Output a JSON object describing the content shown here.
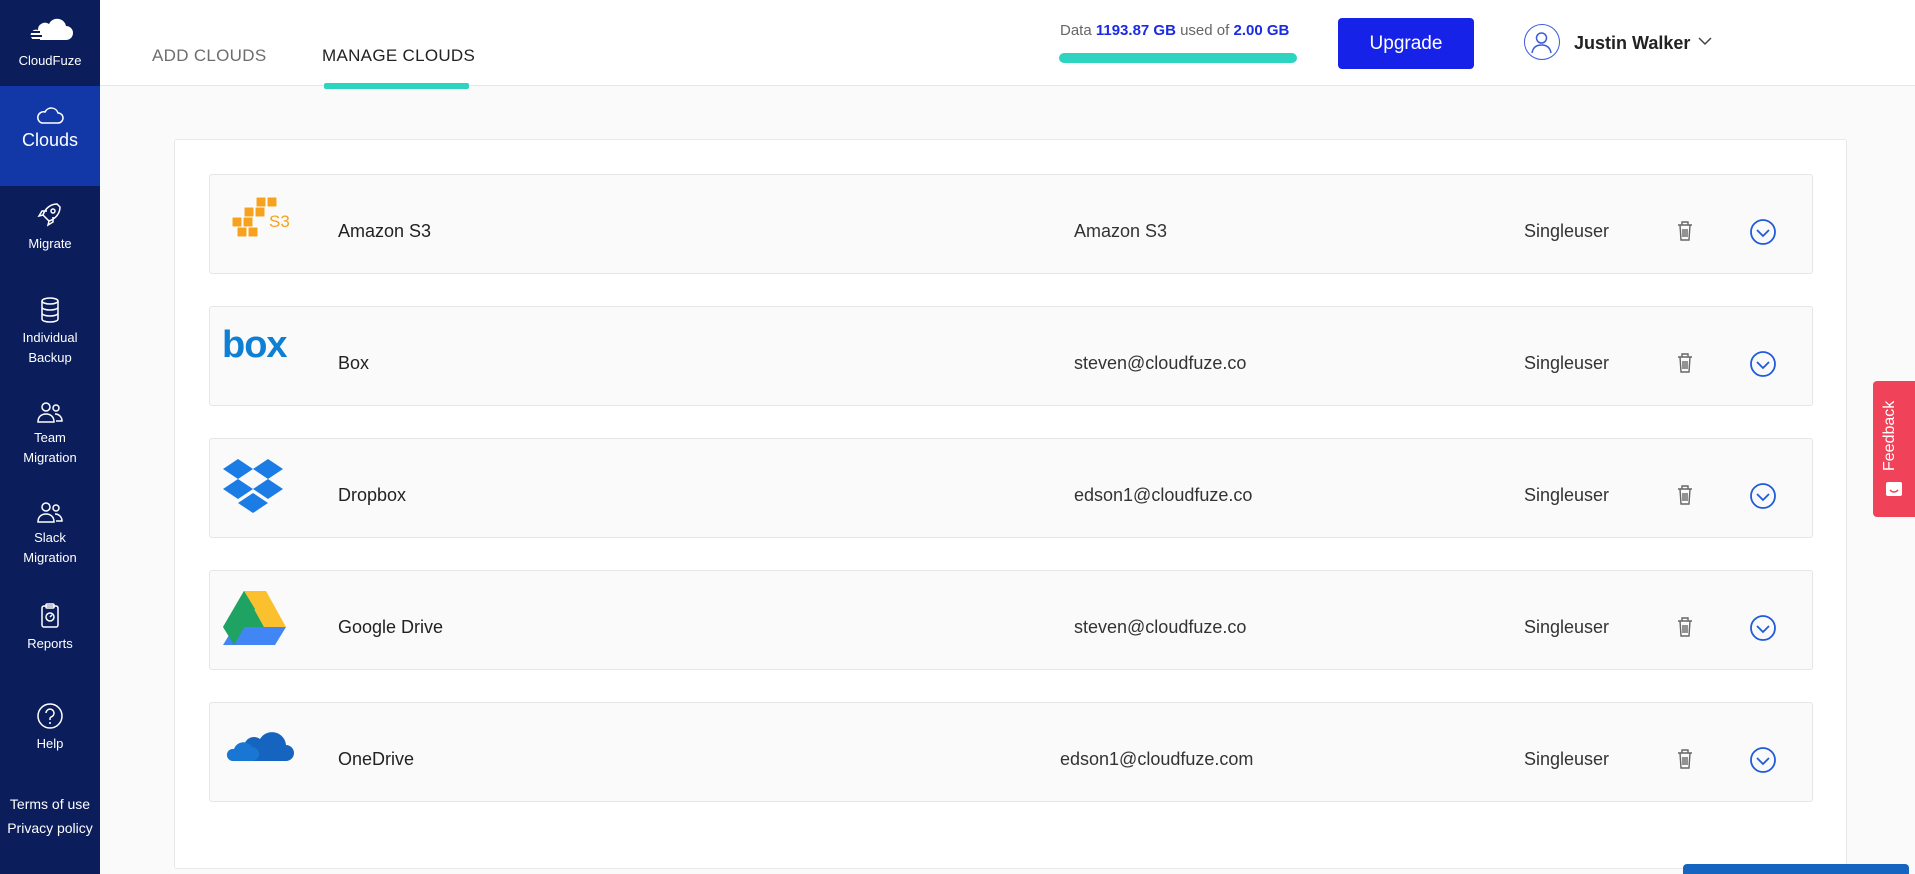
{
  "brand": {
    "name": "CloudFuze",
    "accent": "#0b1e5b",
    "active": "#1238a8",
    "teal": "#2dd4bf"
  },
  "sidebar": {
    "items": [
      {
        "id": "clouds",
        "label": "Clouds",
        "icon": "cloud-icon",
        "active": true
      },
      {
        "id": "migrate",
        "label": "Migrate",
        "icon": "rocket-icon"
      },
      {
        "id": "backup",
        "label_line1": "Individual",
        "label_line2": "Backup",
        "icon": "database-icon"
      },
      {
        "id": "team",
        "label_line1": "Team",
        "label_line2": "Migration",
        "icon": "users-icon"
      },
      {
        "id": "slack",
        "label_line1": "Slack",
        "label_line2": "Migration",
        "icon": "users-icon"
      },
      {
        "id": "reports",
        "label": "Reports",
        "icon": "report-icon"
      },
      {
        "id": "help",
        "label": "Help",
        "icon": "help-icon"
      }
    ],
    "terms": "Terms of use",
    "privacy": "Privacy policy"
  },
  "header": {
    "tab_add": "ADD CLOUDS",
    "tab_manage": "MANAGE CLOUDS",
    "usage_prefix": "Data",
    "usage_used": "1193.87 GB",
    "usage_middle": "used of",
    "usage_total": "2.00 GB",
    "usage_fraction": 1.0,
    "upgrade": "Upgrade",
    "user": "Justin Walker"
  },
  "clouds": [
    {
      "name": "Amazon S3",
      "account": "Amazon S3",
      "type": "Singleuser",
      "logo": "amazon-s3-logo"
    },
    {
      "name": "Box",
      "account": "steven@cloudfuze.co",
      "type": "Singleuser",
      "logo": "box-logo"
    },
    {
      "name": "Dropbox",
      "account": "edson1@cloudfuze.co",
      "type": "Singleuser",
      "logo": "dropbox-logo"
    },
    {
      "name": "Google Drive",
      "account": "steven@cloudfuze.co",
      "type": "Singleuser",
      "logo": "google-drive-logo"
    },
    {
      "name": "OneDrive",
      "account": "edson1@cloudfuze.com",
      "type": "Singleuser",
      "logo": "onedrive-logo"
    }
  ],
  "feedback": "Feedback"
}
